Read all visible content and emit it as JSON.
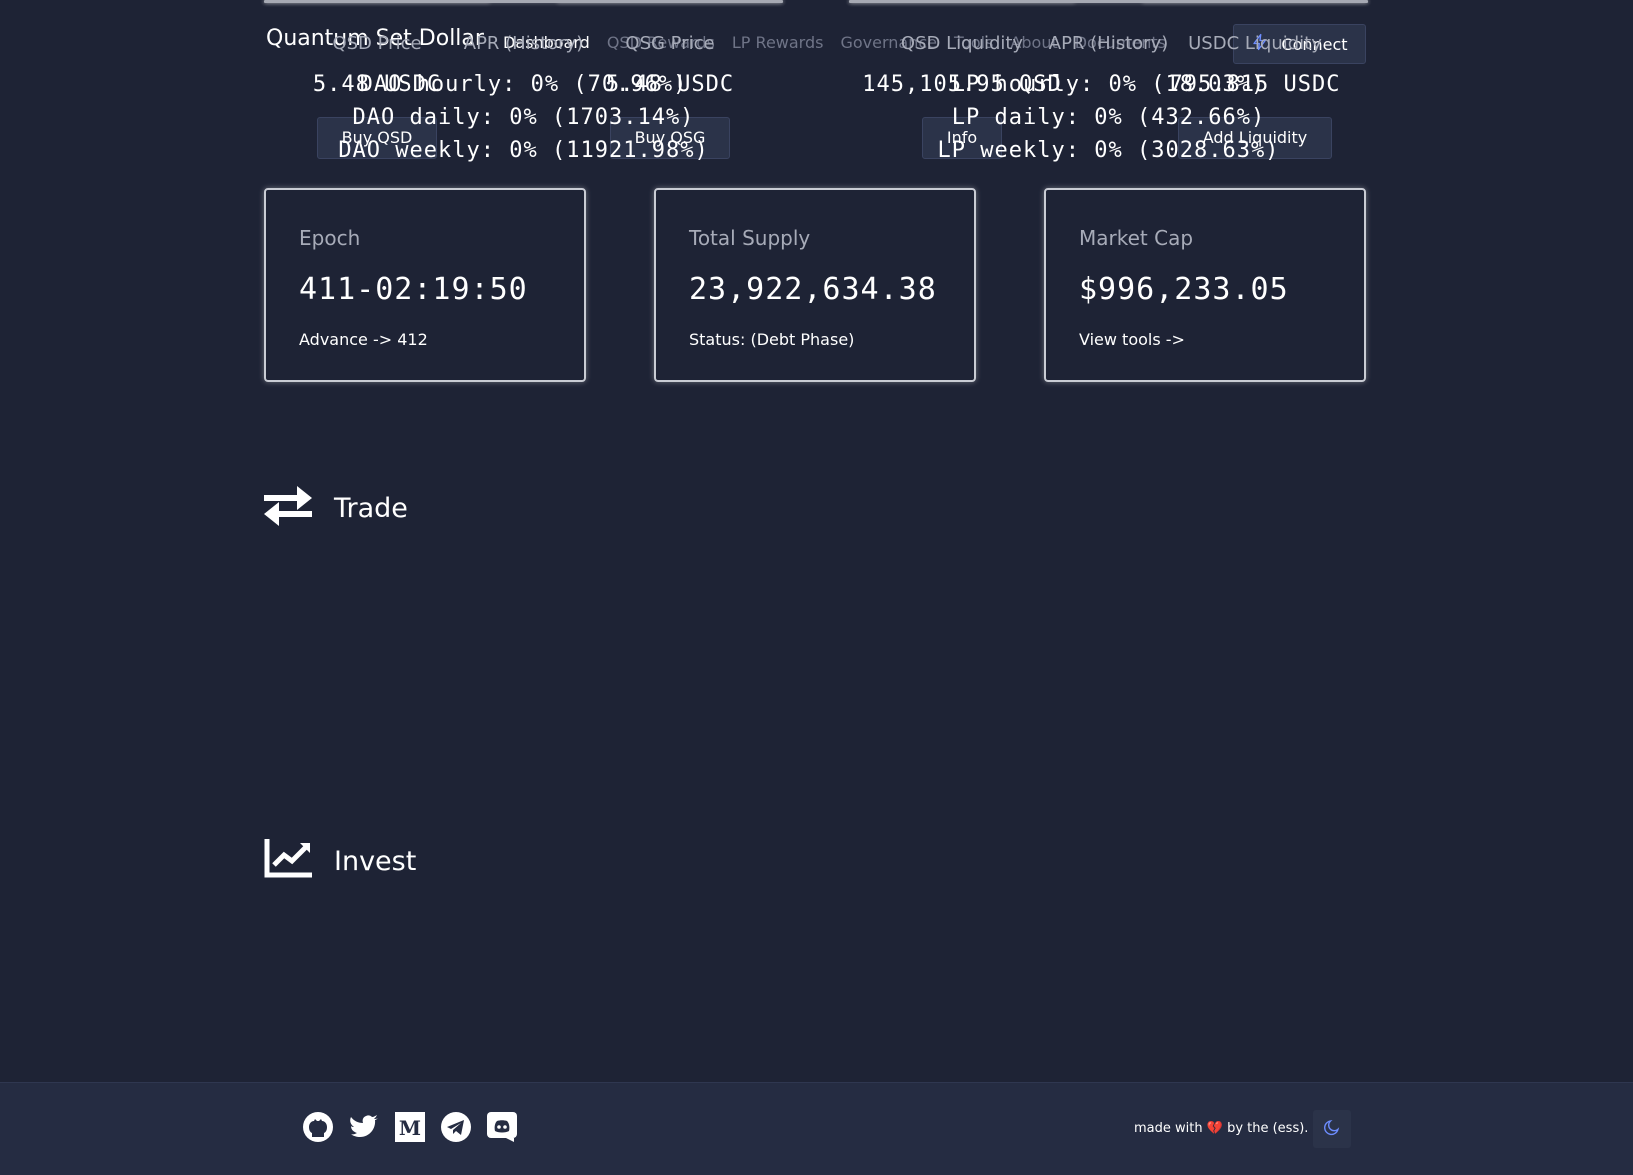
{
  "brand": "Quantum Set Dollar",
  "nav": {
    "items": [
      {
        "label": "Dashboard"
      },
      {
        "label": "QSD Rewards"
      },
      {
        "label": "LP Rewards"
      },
      {
        "label": "Governance"
      },
      {
        "label": "Tools"
      },
      {
        "label": "About"
      },
      {
        "label": "Documents"
      }
    ],
    "active_index": 0
  },
  "connect_label": "Connect",
  "cards": [
    {
      "label": "Epoch",
      "value": "411-02:19:50",
      "sub": "Advance -> 412"
    },
    {
      "label": "Total Supply",
      "value": "23,922,634.38",
      "sub": "Status: (Debt Phase)"
    },
    {
      "label": "Market Cap",
      "value": "$996,233.05",
      "sub": "View tools ->"
    }
  ],
  "trade": {
    "title": "Trade",
    "columns": [
      {
        "label": "QSD Price",
        "value": "5.48 USDC",
        "button": "Buy QSD"
      },
      {
        "label": "QSG Price",
        "value": "5.48 USDC",
        "button": "Buy QSG"
      },
      {
        "label": "QSD Liquidity",
        "value": "145,105.95 QSD",
        "button": "Info"
      },
      {
        "label": "USDC Liquidity",
        "value": "795.815 USDC",
        "button": "Add Liquidity"
      }
    ]
  },
  "invest": {
    "title": "Invest",
    "columns": [
      {
        "label": "APR (History)",
        "lines": [
          "DAO hourly: 0% (70.96%)",
          "DAO daily: 0% (1703.14%)",
          "DAO weekly: 0% (11921.98%)"
        ]
      },
      {
        "label": "APR (History)",
        "lines": [
          "LP hourly: 0% (18.03%)",
          "LP daily: 0% (432.66%)",
          "LP weekly: 0% (3028.63%)"
        ]
      }
    ]
  },
  "footer": {
    "socials": [
      "github-icon",
      "twitter-icon",
      "medium-icon",
      "telegram-icon",
      "discord-icon"
    ],
    "made_prefix": "made with",
    "made_suffix": "by the (ess).",
    "heart": "💔"
  },
  "colors": {
    "background": "#1e2335",
    "footer": "#252c42",
    "button": "#2b3349",
    "muted": "#a7abb8",
    "nav_inactive": "#6f7487"
  }
}
